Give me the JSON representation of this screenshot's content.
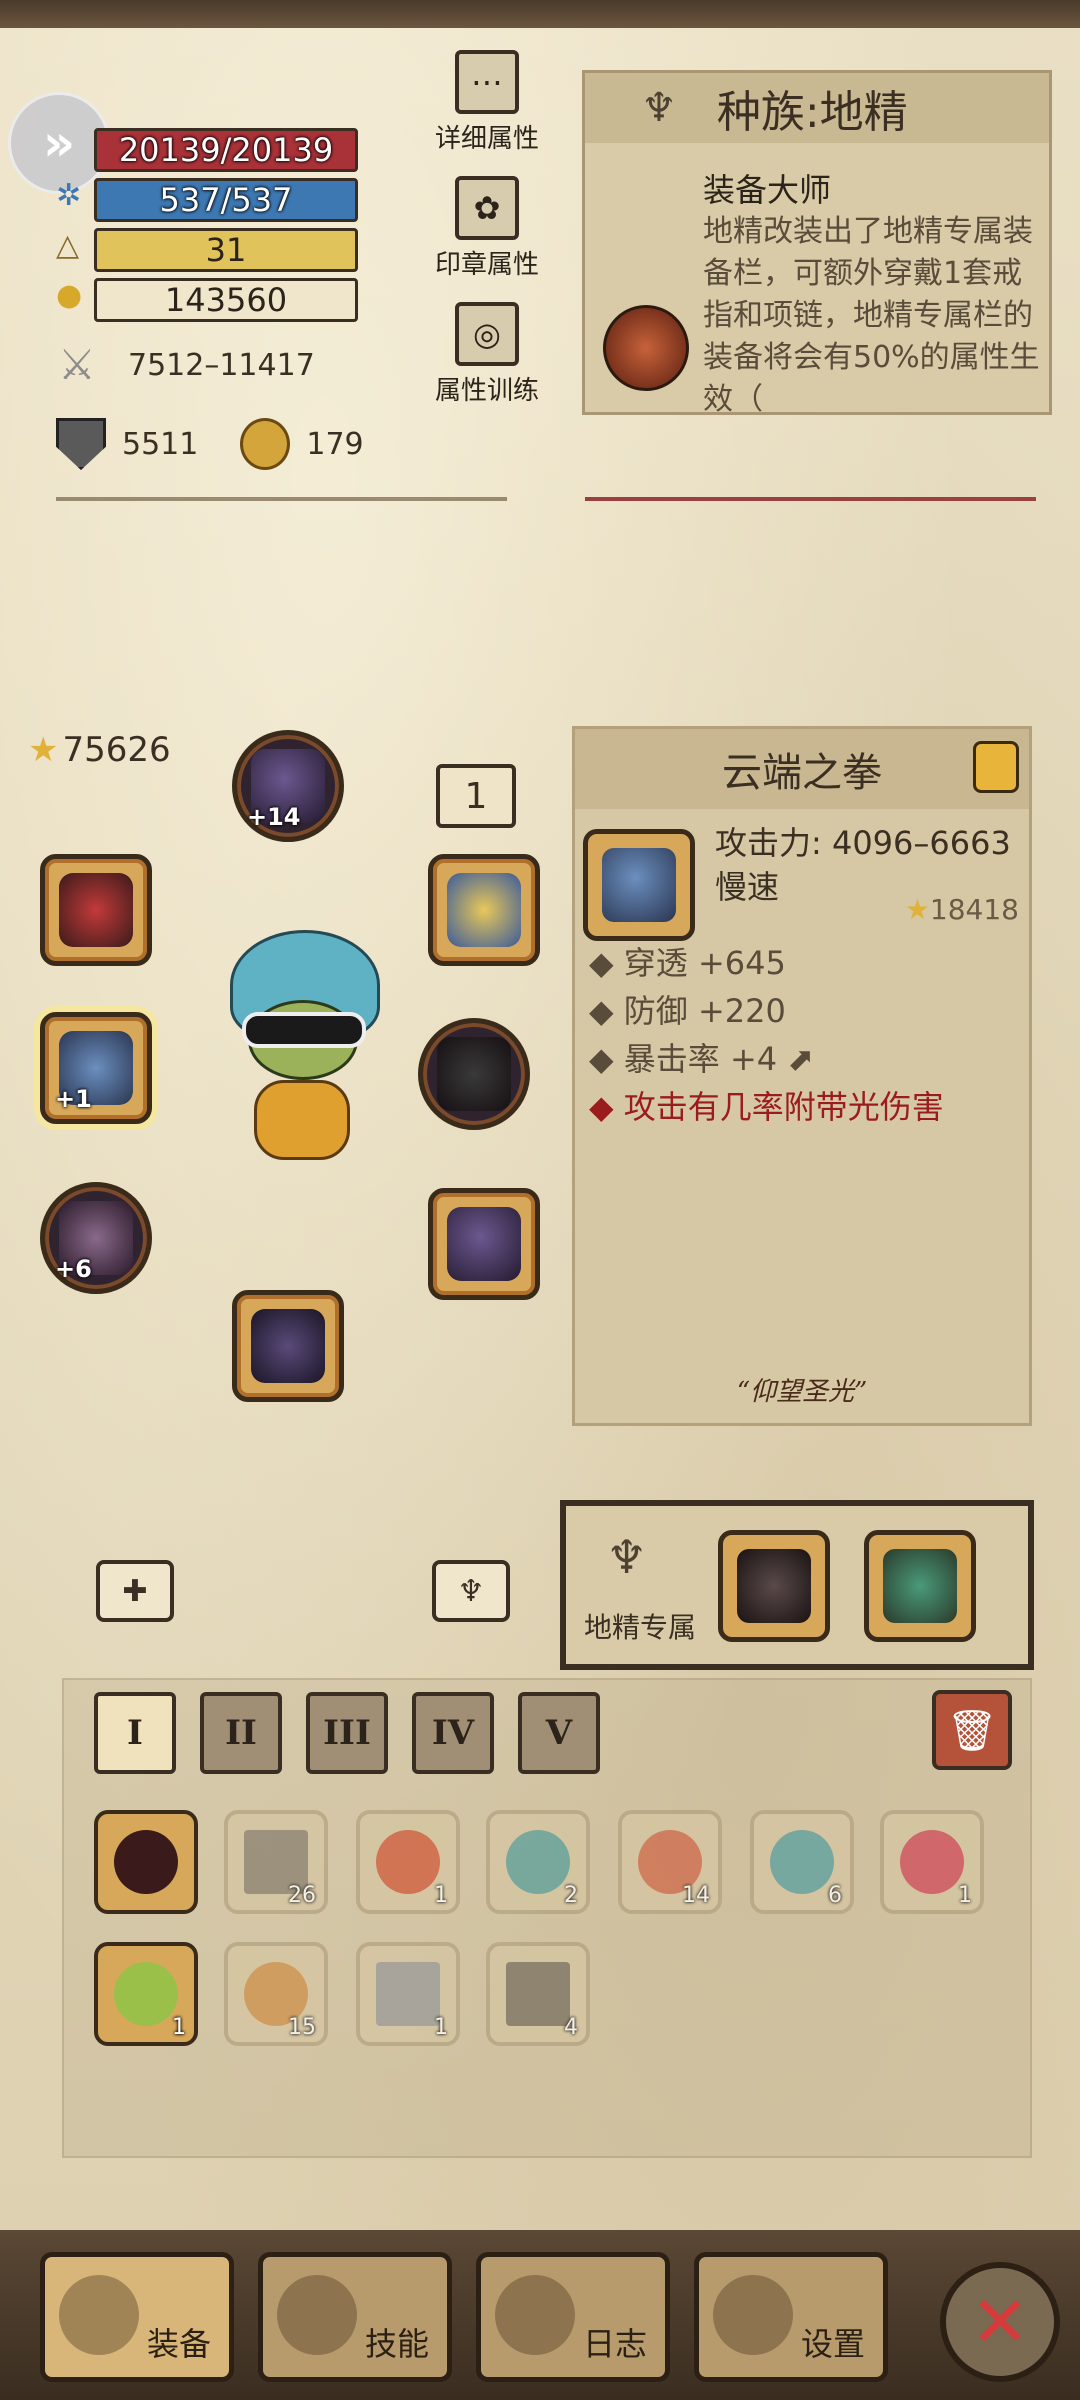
{
  "stats": {
    "hp": "20139/20139",
    "mp": "537/537",
    "level": "31",
    "gold": "143560",
    "attack": "7512–11417",
    "defense": "5511",
    "gear_key": "179"
  },
  "tools": {
    "detail": "详细属性",
    "seal": "印章属性",
    "training": "属性训练"
  },
  "race": {
    "title": "种族:地精",
    "skill_name": "装备大师",
    "description": "地精改装出了地精专属装备栏，可额外穿戴1套戒指和项链，地精专属栏的装备将会有50%的属性生效（"
  },
  "equipment": {
    "score": "75626",
    "level_badge": "1",
    "helmet_plus": "+14",
    "weapon_plus": "+1",
    "glove_plus": "+6"
  },
  "item": {
    "name": "云端之拳",
    "attack": "攻击力: 4096–6663",
    "speed": "慢速",
    "score": "18418",
    "stats": [
      "穿透 +645",
      "防御 +220",
      "暴击率 +4"
    ],
    "special": "攻击有几率附带光伤害",
    "quote": "“仰望圣光”"
  },
  "exclusive": {
    "label": "地精专属"
  },
  "inventory": {
    "tabs": [
      "I",
      "II",
      "III",
      "IV",
      "V"
    ],
    "row1_counts": [
      "26",
      "1",
      "2",
      "14",
      "6",
      "1"
    ],
    "row2_counts": [
      "1",
      "15",
      "1",
      "4"
    ]
  },
  "nav": {
    "equip": "装备",
    "skills": "技能",
    "log": "日志",
    "settings": "设置"
  },
  "colors": {
    "hp_bar": "#a83238",
    "mp_bar": "#3e78b2",
    "level_bar": "#e0c35a",
    "special_text": "#9b1c1c"
  }
}
